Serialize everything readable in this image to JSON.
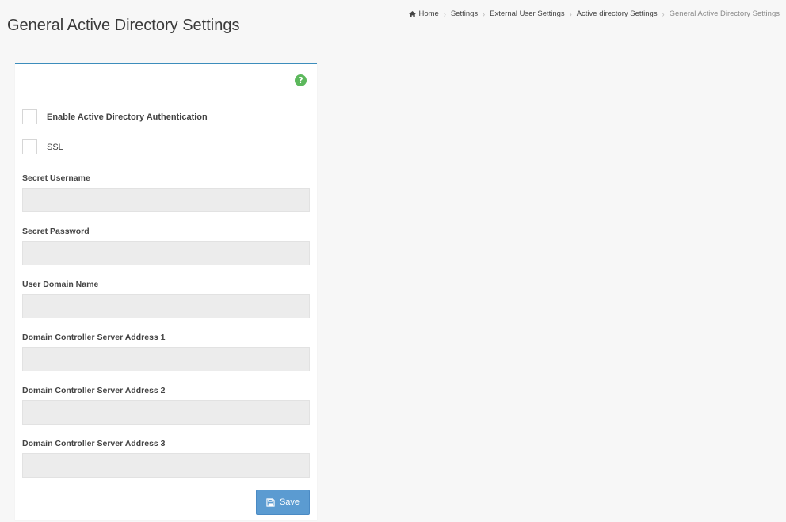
{
  "page": {
    "title": "General Active Directory Settings"
  },
  "breadcrumb": {
    "items": [
      {
        "label": "Home"
      },
      {
        "label": "Settings"
      },
      {
        "label": "External User Settings"
      },
      {
        "label": "Active directory Settings"
      },
      {
        "label": "General Active Directory Settings"
      }
    ]
  },
  "form": {
    "help_glyph": "?",
    "enable_ad_label": "Enable Active Directory Authentication",
    "enable_ad_checked": false,
    "ssl_label": "SSL",
    "ssl_checked": false,
    "fields": [
      {
        "label": "Secret Username",
        "value": "",
        "placeholder": ""
      },
      {
        "label": "Secret Password",
        "value": "",
        "placeholder": ""
      },
      {
        "label": "User Domain Name",
        "value": "",
        "placeholder": ""
      },
      {
        "label": "Domain Controller Server Address 1",
        "value": "",
        "placeholder": ""
      },
      {
        "label": "Domain Controller Server Address 2",
        "value": "",
        "placeholder": ""
      },
      {
        "label": "Domain Controller Server Address 3",
        "value": "",
        "placeholder": ""
      }
    ],
    "save_label": "Save"
  },
  "icons": {
    "home": "home-icon",
    "help": "help-icon",
    "save": "floppy-disk-icon"
  },
  "colors": {
    "accent": "#3c8dbc",
    "save_button": "#5b9bd1",
    "help": "#5cb85c",
    "input_bg": "#ececec"
  }
}
